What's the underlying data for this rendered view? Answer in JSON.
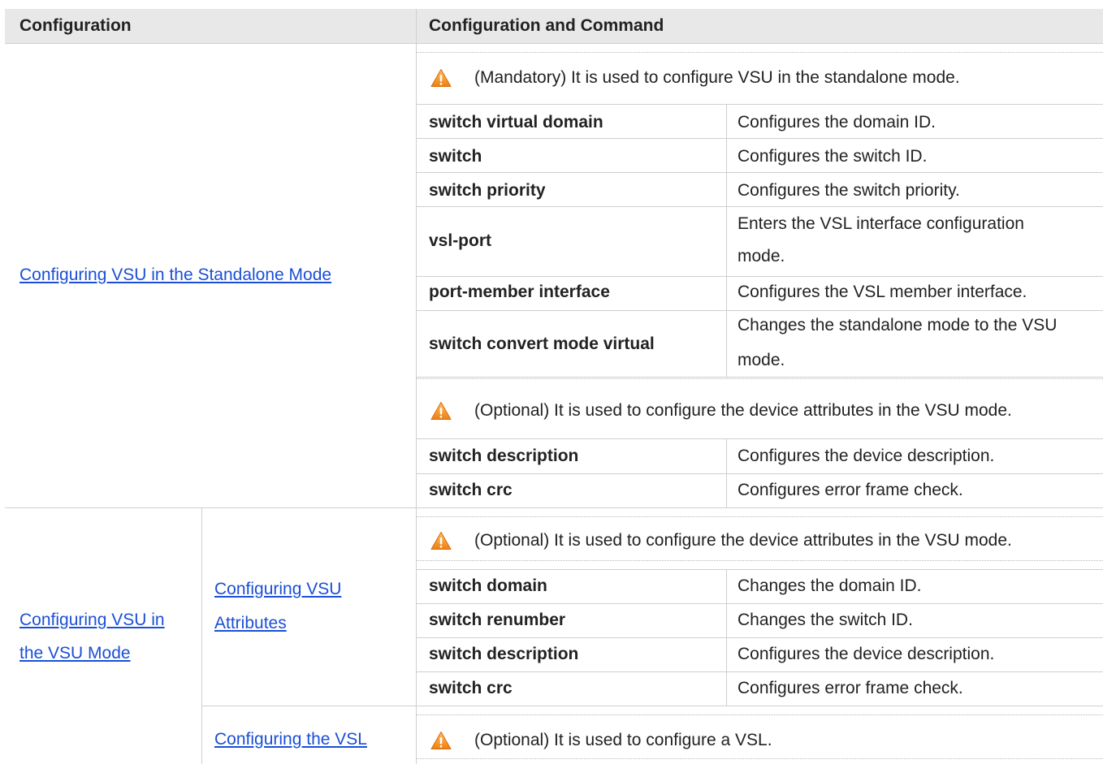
{
  "header": {
    "col1": "Configuration",
    "col2": "Configuration and Command"
  },
  "section_standalone": {
    "link": "Configuring VSU in the Standalone Mode",
    "note_mandatory": "(Mandatory) It is used to configure VSU in the standalone mode.",
    "rows": [
      {
        "cmd": "switch virtual domain",
        "desc": "Configures the domain ID."
      },
      {
        "cmd": "switch",
        "desc": "Configures the switch ID."
      },
      {
        "cmd": "switch priority",
        "desc": "Configures the switch priority."
      },
      {
        "cmd": "vsl-port",
        "desc_line1": "Enters the VSL interface configuration",
        "desc_line2": "mode."
      },
      {
        "cmd": "port-member interface",
        "desc": "Configures the VSL member interface."
      },
      {
        "cmd": "switch convert mode virtual",
        "desc_line1": "Changes the standalone mode to the VSU",
        "desc_line2": "mode."
      }
    ],
    "note_optional": "(Optional) It is used to configure the device attributes in the VSU mode.",
    "rows2": [
      {
        "cmd": "switch description",
        "desc": "Configures the device description."
      },
      {
        "cmd": "switch crc",
        "desc": "Configures error frame check."
      }
    ]
  },
  "section_vsu": {
    "link_line1": "Configuring VSU in",
    "link_line2": "the VSU Mode",
    "attr_link_line1": "Configuring VSU",
    "attr_link_line2": "Attributes",
    "note_optional": "(Optional) It is used to configure the device attributes in the VSU mode.",
    "rows": [
      {
        "cmd": "switch domain",
        "desc": "Changes the domain ID."
      },
      {
        "cmd": "switch renumber",
        "desc": "Changes the switch ID."
      },
      {
        "cmd": "switch description",
        "desc": "Configures the device description."
      },
      {
        "cmd": "switch crc",
        "desc": "Configures error frame check."
      }
    ],
    "vsl_link": "Configuring the VSL",
    "vsl_note": "(Optional) It is used to configure a VSL."
  },
  "colors": {
    "header_bg": "#e8e8e8",
    "link": "#1a4fd6",
    "warning": "#f39a1e"
  },
  "icons": [
    "warning-icon"
  ]
}
